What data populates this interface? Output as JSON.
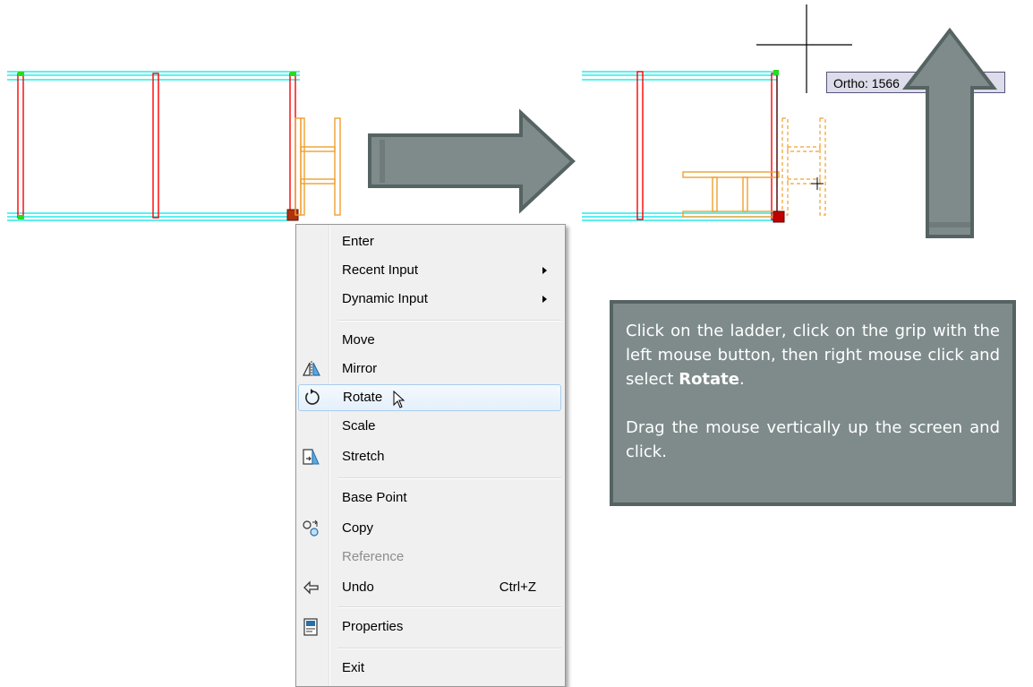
{
  "context_menu": {
    "items": [
      {
        "label": "Enter",
        "icon": ""
      },
      {
        "label": "Recent Input",
        "icon": "",
        "submenu": true
      },
      {
        "label": "Dynamic Input",
        "icon": "",
        "submenu": true
      },
      {
        "label": "Move",
        "icon": ""
      },
      {
        "label": "Mirror",
        "icon": "mirror-icon"
      },
      {
        "label": "Rotate",
        "icon": "rotate-icon"
      },
      {
        "label": "Scale",
        "icon": ""
      },
      {
        "label": "Stretch",
        "icon": "stretch-icon"
      },
      {
        "label": "Base Point",
        "icon": ""
      },
      {
        "label": "Copy",
        "icon": "copy-icon"
      },
      {
        "label": "Reference",
        "icon": "",
        "disabled": true
      },
      {
        "label": "Undo",
        "icon": "undo-icon",
        "shortcut": "Ctrl+Z"
      },
      {
        "label": "Properties",
        "icon": "properties-icon"
      },
      {
        "label": "Exit",
        "icon": ""
      }
    ]
  },
  "tooltip": {
    "text": "Ortho: 1566"
  },
  "callout": {
    "paragraph1_prefix": "Click on the ladder, click on the grip with the left mouse button, then right mouse click and select ",
    "paragraph1_bold": "Rotate",
    "paragraph1_suffix": ".",
    "paragraph2": "Drag the mouse vertically up the screen and click."
  },
  "colors": {
    "beam_line": "#00e5e5",
    "post_red": "#ff0000",
    "ladder_orange": "#f0a030",
    "arrow_fill": "#7f8b8b",
    "arrow_stroke": "#566363",
    "callout_bg": "#7f8b8b"
  }
}
